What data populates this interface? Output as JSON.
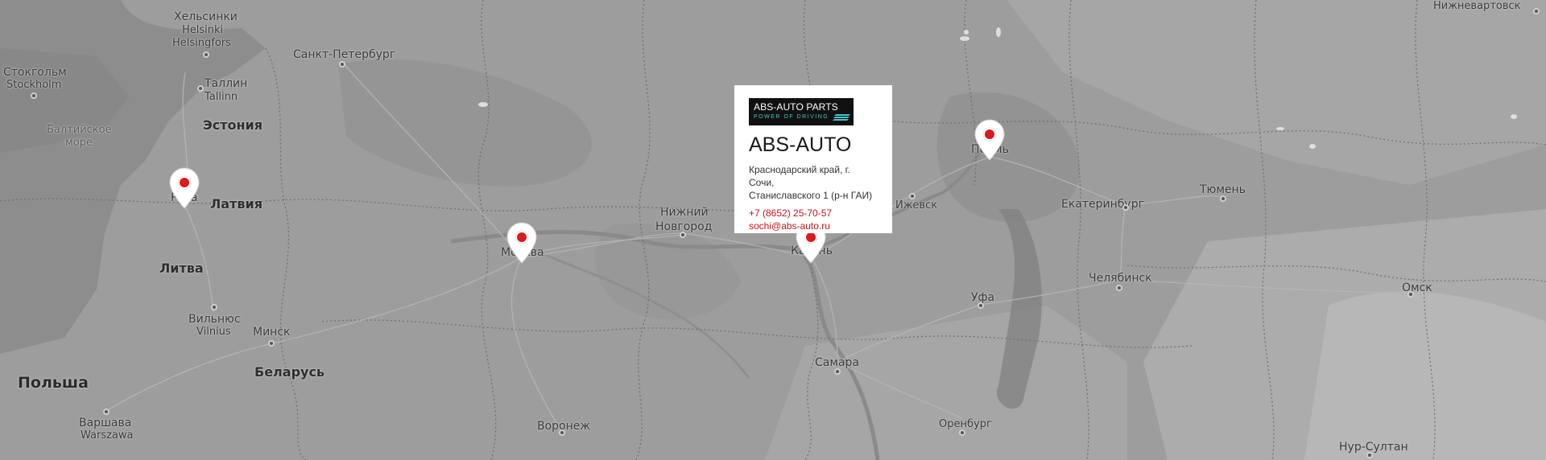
{
  "map": {
    "labels": {
      "helsinki_ru": "Хельсинки",
      "helsinki_fi": "Helsinki",
      "helsingfors": "Helsingfors",
      "spb": "Санкт-Петербург",
      "stockholm_ru": "Стокгольм",
      "stockholm_sv": "Stockholm",
      "tallinn_ru": "Таллин",
      "tallinn_et": "Tallinn",
      "baltic_sea": "Балтийское море",
      "estonia": "Эстония",
      "riga": "Рига",
      "latvia": "Латвия",
      "lithuania": "Литва",
      "vilnius_ru": "Вильнюс",
      "vilnius_lt": "Vilnius",
      "minsk": "Минск",
      "belarus": "Беларусь",
      "poland": "Польша",
      "warsaw_ru": "Варшава",
      "warsaw_pl": "Warszawa",
      "voronezh": "Воронеж",
      "moscow": "Москва",
      "n_novgorod_1": "Нижний",
      "n_novgorod_2": "Новгород",
      "kazan": "Казань",
      "izhevsk": "Ижевск",
      "perm": "Пермь",
      "samara": "Самара",
      "ufa": "Уфа",
      "orenburg": "Оренбург",
      "ekaterinburg": "Екатеринбург",
      "tyumen": "Тюмень",
      "chelyabinsk": "Челябинск",
      "omsk": "Омск",
      "nur_sultan": "Нур-Султан",
      "nizhnevartovsk": "Нижневартовск"
    }
  },
  "markers": [
    {
      "id": "riga"
    },
    {
      "id": "moscow"
    },
    {
      "id": "kazan"
    },
    {
      "id": "perm"
    }
  ],
  "popup": {
    "logo_title": "ABS-AUTO PARTS",
    "logo_subtitle": "POWER OF DRIVING",
    "company": "ABS-AUTO",
    "address_line1": "Краснодарский край, г. Сочи,",
    "address_line2": "Станиславского 1 (р-н ГАИ)",
    "phone": "+7 (8652) 25-70-57",
    "email": "sochi@abs-auto.ru"
  },
  "colors": {
    "marker_red": "#d21f1f",
    "link_red": "#c0171f",
    "logo_accent": "#4ec3c9"
  }
}
